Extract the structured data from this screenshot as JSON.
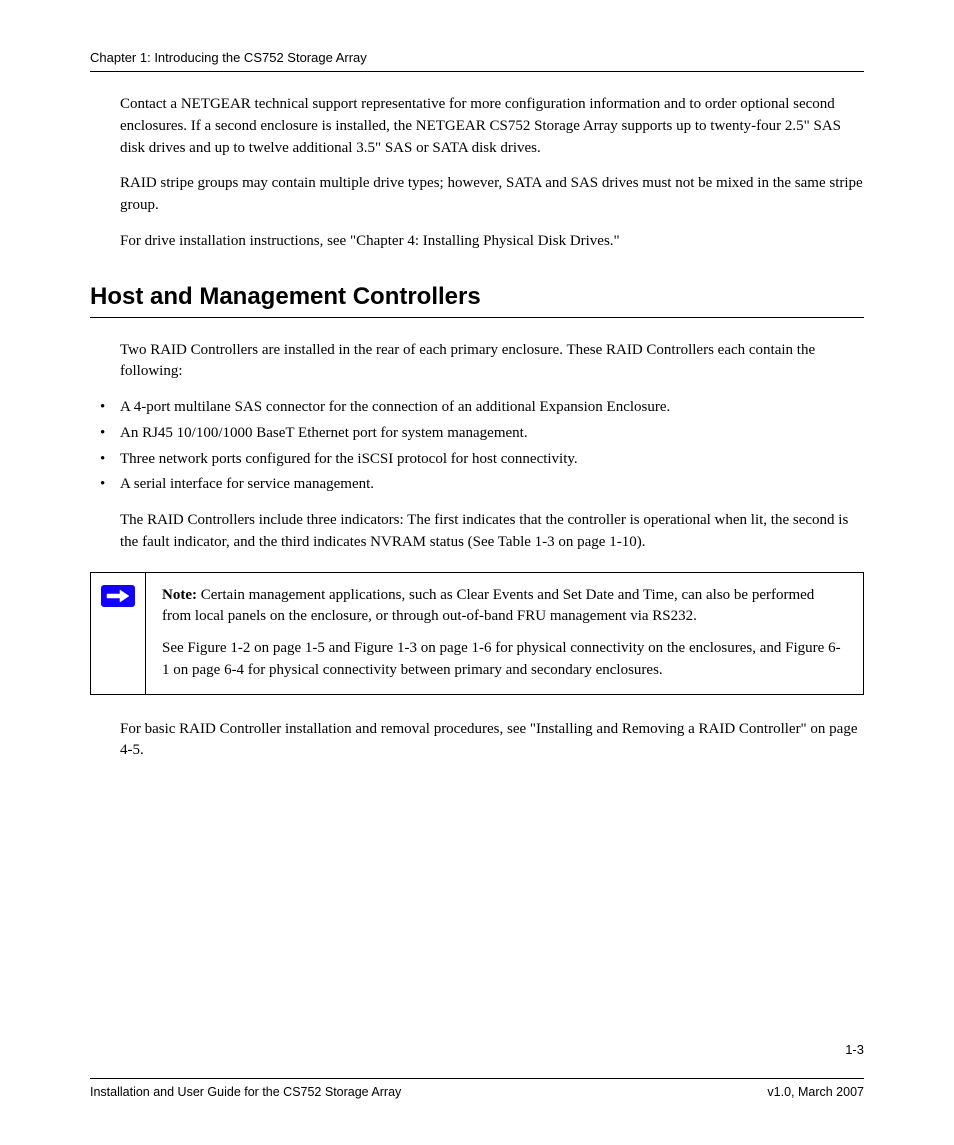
{
  "header": {
    "title": "Chapter 1: Introducing the CS752 Storage Array"
  },
  "intro_paragraphs": [
    "Contact a NETGEAR technical support representative for more configuration information and to order optional second enclosures. If a second enclosure is installed, the NETGEAR CS752 Storage Array supports up to twenty-four 2.5\" SAS disk drives and up to twelve additional 3.5\" SAS or SATA disk drives.",
    "RAID stripe groups may contain multiple drive types; however, SATA and SAS drives must not be mixed in the same stripe group.",
    "For drive installation instructions, see \"Chapter 4: Installing Physical Disk Drives.\""
  ],
  "section": {
    "heading": "Host and Management Controllers",
    "lead": "Two RAID Controllers are installed in the rear of each primary enclosure. These RAID Controllers each contain the following:",
    "bullets": [
      "A 4-port multilane SAS connector for the connection of an additional Expansion Enclosure.",
      "An RJ45 10/100/1000 BaseT Ethernet port for system management.",
      "Three network ports configured for the iSCSI protocol for host connectivity.",
      "A serial interface for service management."
    ],
    "after": "The RAID Controllers include three indicators: The first indicates that the controller is operational when lit, the second is the fault indicator, and the third indicates NVRAM status (See Table 1-3 on page 1-10).",
    "note": {
      "label": "Note:",
      "line1": "Certain management applications, such as Clear Events and Set Date and Time, can also be performed from local panels on the enclosure, or through out-of-band FRU management via RS232.",
      "line2": "See Figure 1-2 on page 1-5 and Figure 1-3 on page 1-6 for physical connectivity on the enclosures, and Figure 6-1 on page 6-4 for physical connectivity between primary and secondary enclosures."
    },
    "closing": "For basic RAID Controller installation and removal procedures, see \"Installing and Removing a RAID Controller\" on page 4-5."
  },
  "page_number": "1-3",
  "footer": {
    "left": "Installation and User Guide for the CS752 Storage Array",
    "right": "v1.0, March 2007"
  }
}
